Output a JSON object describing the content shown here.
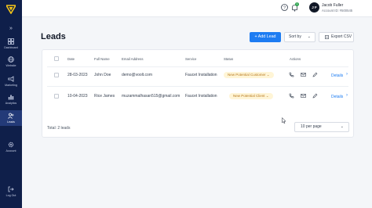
{
  "sidebar": {
    "collapse_label": "»",
    "items": [
      {
        "label": "Dashboard",
        "icon": "grid-icon"
      },
      {
        "label": "Website",
        "icon": "globe-icon"
      },
      {
        "label": "Analytics",
        "icon": "bar-chart-icon"
      },
      {
        "label": "Leads",
        "icon": "users-icon",
        "active": true
      },
      {
        "label": "Marketing",
        "icon": "megaphone-icon"
      },
      {
        "label": "Account",
        "icon": "gear-icon"
      },
      {
        "label": "Log Out",
        "icon": "logout-icon"
      }
    ]
  },
  "topbar": {
    "notification_count": "1",
    "avatar_initials": "J F",
    "user_name": "Jacob Fuller",
    "account_id": "Account ID: #500545"
  },
  "page": {
    "title": "Leads",
    "add_button": "+ Add Lead",
    "sort_label": "Sort by",
    "export_label": "Export CSV"
  },
  "table": {
    "headers": [
      "Date",
      "Full Name",
      "Email Address",
      "Service",
      "Status",
      "Actions"
    ],
    "rows": [
      {
        "date": "28-03-2023",
        "name": "John Doe",
        "email": "demo@voolt.com",
        "service": "Faucet Installation",
        "status": "New Potential Customer",
        "details": "Details"
      },
      {
        "date": "10-04-2023",
        "name": "Rice James",
        "email": "muzammalhasan515@gmail.com",
        "service": "Faucet Installation",
        "status": "New Potential Client",
        "details": "Details"
      }
    ],
    "total": "Total: 2 leads",
    "per_page": "10 per page"
  },
  "colors": {
    "sidebar": "#0f1f4a",
    "accent": "#1d7cf2",
    "status_bg": "#fff5d6",
    "status_text": "#b7791f"
  }
}
